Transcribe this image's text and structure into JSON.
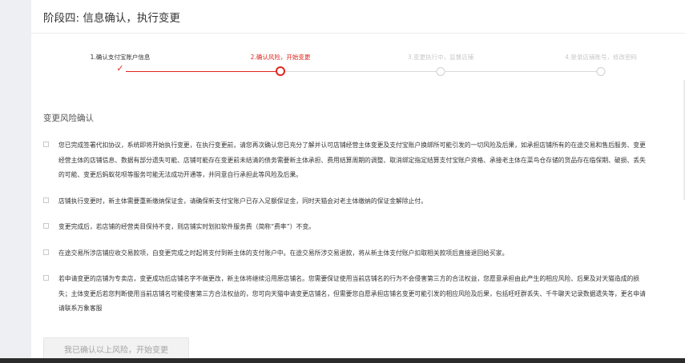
{
  "header": {
    "title": "阶段四: 信息确认，执行变更"
  },
  "steps": [
    {
      "label": "1.确认支付宝账户信息",
      "state": "done"
    },
    {
      "label": "2.确认风险，开始变更",
      "state": "active"
    },
    {
      "label": "3.变更执行中，监督店铺",
      "state": "pending"
    },
    {
      "label": "4.登录店铺账号，修改密码",
      "state": "pending"
    }
  ],
  "icons": {
    "done": "check-icon",
    "active": "active-step-circle-icon",
    "pending": "pending-step-circle-icon"
  },
  "colors": {
    "accent": "#e1251b",
    "pending": "#cfcfcf",
    "text": "#333333"
  },
  "section": {
    "title": "变更风险确认"
  },
  "risk_items": [
    "您已完成签署代扣协议，系统即将开始执行变更，在执行变更前，请您再次确认您已充分了解并认可店铺经营主体变更及支付宝账户换绑所可能引发的一切风险及后果，如承担店铺所有的在途交易和售后服务、变更经营主体的店铺信息、数据有部分遗失可能、店铺可能存在变更前未结清的债务需要新主体承担、费用结算周期的调整、取消绑定指定结算支付宝账户资格、承接老主体在菜鸟仓存储的货品存在临保期、破损、丢失的可能、变更后蚂蚁花呗等服务可能无法成功开通等，并同意自行承担此等风险及后果。",
    "店铺执行变更时，新主体需要重新缴纳保证金，请确保新支付宝账户已存入足额保证金，同时天猫会对老主体缴纳的保证金解除止付。",
    "变更完成后，若店铺的经营类目保持不变，则店铺实时划扣软件服务费（简称“费率”）不变。",
    "在途交易所涉店铺应收交易款项，自变更完成之时起将支付到新主体的支付账户中。在途交易所涉交易退款，将从新主体支付账户扣取相关款项后直接退回给买家。",
    "若申请变更的店铺为专卖店，变更成功后店铺名字不做更改，新主体将继续沿用原店铺名。您需要保证使用当前店铺名的行为不会侵害第三方的合法权益，您愿意承担由此产生的相应风险、后果及对天猫造成的损失；主体变更后若您判断使用当前店铺名可能侵害第三方合法权益的，您可向天猫申请变更店铺名，但需要您自愿承担店铺名变更可能引发的相应风险及后果，包括旺旺群丢失、千牛聊天记录数据遗失等，更名申请请联系万象客服"
  ],
  "confirm_button": {
    "label": "我已确认以上风险，开始变更"
  }
}
